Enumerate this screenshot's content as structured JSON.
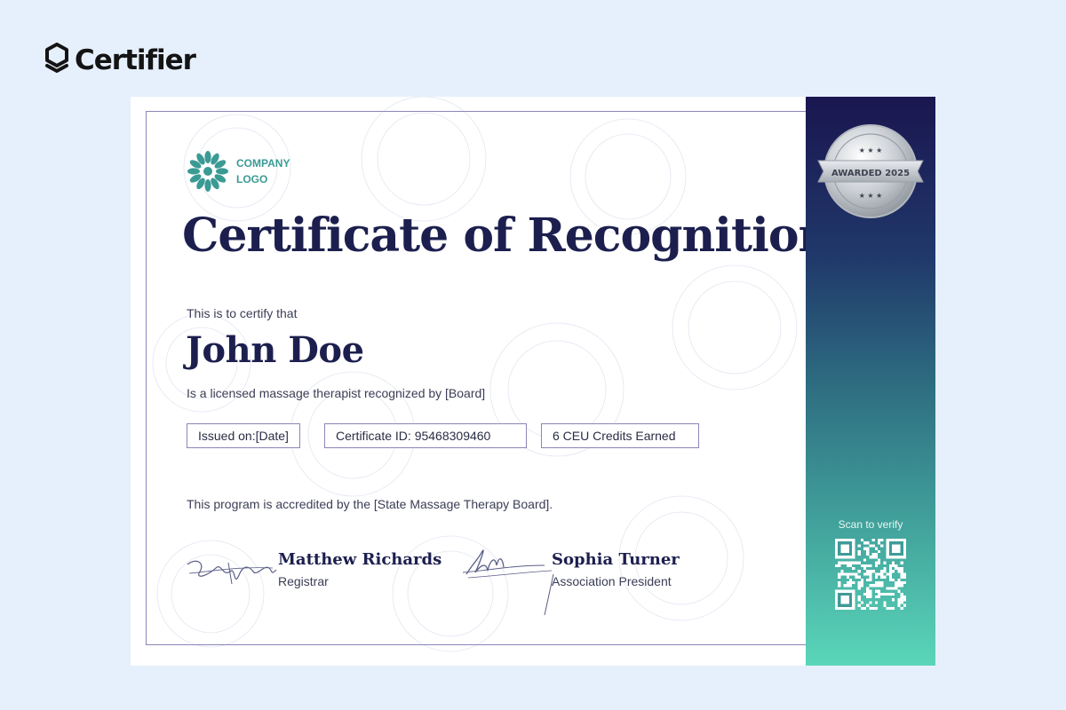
{
  "brand": {
    "name": "Certifier"
  },
  "certificate": {
    "logo_text_line1": "COMPANY",
    "logo_text_line2": "LOGO",
    "title": "Certificate of Recognition",
    "intro": "This is to certify that",
    "recipient": "John Doe",
    "description": "Is a licensed massage therapist recognized by [Board]",
    "chips": {
      "issued": "Issued on:[Date]",
      "certificate_id": "Certificate ID: 95468309460",
      "credits": "6 CEU Credits Earned"
    },
    "accreditation": "This program is accredited by the [State Massage Therapy Board].",
    "signatures": [
      {
        "name": "Matthew Richards",
        "role": "Registrar"
      },
      {
        "name": "Sophia Turner",
        "role": "Association President"
      }
    ]
  },
  "sidebar": {
    "badge_text": "AWARDED 2025",
    "scan_label": "Scan to verify"
  },
  "colors": {
    "background": "#e6f0fc",
    "navy": "#1c1f4e",
    "teal_logo": "#3a9a94",
    "frame": "#8a86b8",
    "gradient_top": "#1a1650",
    "gradient_bottom": "#5ad6b9"
  },
  "icons": [
    "certifier-logo-icon",
    "company-logo-flower-icon",
    "award-badge-icon",
    "qr-code-icon"
  ]
}
